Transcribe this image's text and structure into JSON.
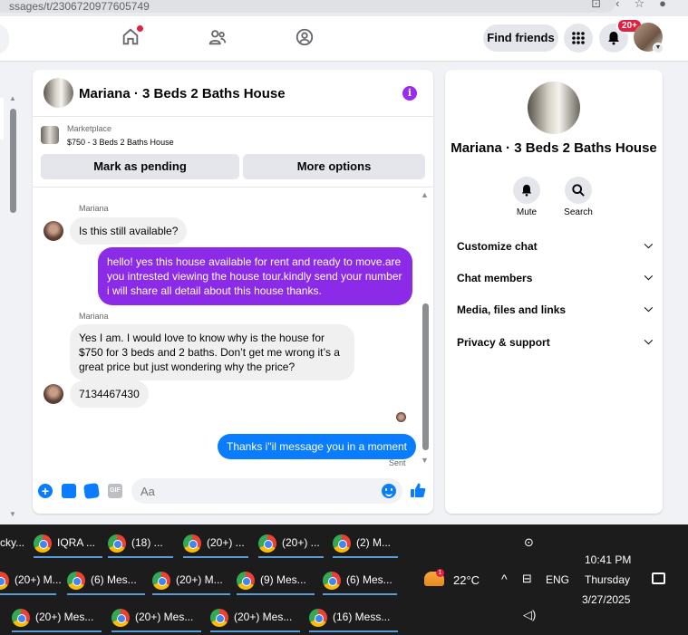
{
  "browser": {
    "url_fragment": "ssages/t/2306720977605749",
    "icons": [
      "extensions-icon",
      "back-icon",
      "star-icon",
      "profile-icon",
      "menu-icon"
    ]
  },
  "topbar": {
    "find_friends": "Find friends",
    "notification_badge": "20+",
    "icons": [
      "home-icon",
      "friends-icon",
      "groups-icon",
      "apps-menu-icon",
      "bell-icon"
    ]
  },
  "chat": {
    "title": "Mariana · 3 Beds 2 Baths House",
    "marketplace_label": "Marketplace",
    "marketplace_listing": "$750 - 3 Beds 2 Baths House",
    "mark_pending": "Mark as pending",
    "more_options": "More options",
    "messages": [
      {
        "sender": "Mariana",
        "text": "Is this still available?"
      },
      {
        "text_line1": "hello! yes this house available for rent and ready to move.are",
        "text_line2": "you intrested viewing the house tour.kindly send your number",
        "text_line3": "i will share all detail about this house thanks."
      },
      {
        "sender": "Mariana",
        "text_line1": "Yes I am. I would love to know why is the house for",
        "text_line2": "$750 for 3 beds and 2 baths. Don’t get me wrong it’s a",
        "text_line3": "great price but just wondering why the price?"
      },
      {
        "text": "7134467430"
      },
      {
        "text": "Thanks i\"il message you in a moment"
      }
    ],
    "sent_label": "Sent",
    "input_placeholder": "Aa",
    "gif_label": "GIF"
  },
  "side": {
    "title": "Mariana · 3 Beds 2 Baths House",
    "mute": "Mute",
    "search": "Search",
    "rows": [
      "Customize chat",
      "Chat members",
      "Media, files and links",
      "Privacy & support"
    ]
  },
  "taskbar": {
    "row1": [
      "cky...",
      "IQRA ...",
      "(18) ...",
      "(20+) ...",
      "(20+) ...",
      "(2) M..."
    ],
    "row2": [
      "(20+) M...",
      "(6) Mes...",
      "(20+) M...",
      "(9) Mes...",
      "(6) Mes..."
    ],
    "row3": [
      "(20+) Mes...",
      "(20+) Mes...",
      "(20+) Mes...",
      "(16) Mess..."
    ],
    "temperature": "22°C",
    "weather_badge": "1",
    "language": "ENG",
    "time": "10:41 PM",
    "day": "Thursday",
    "date": "3/27/2025"
  }
}
